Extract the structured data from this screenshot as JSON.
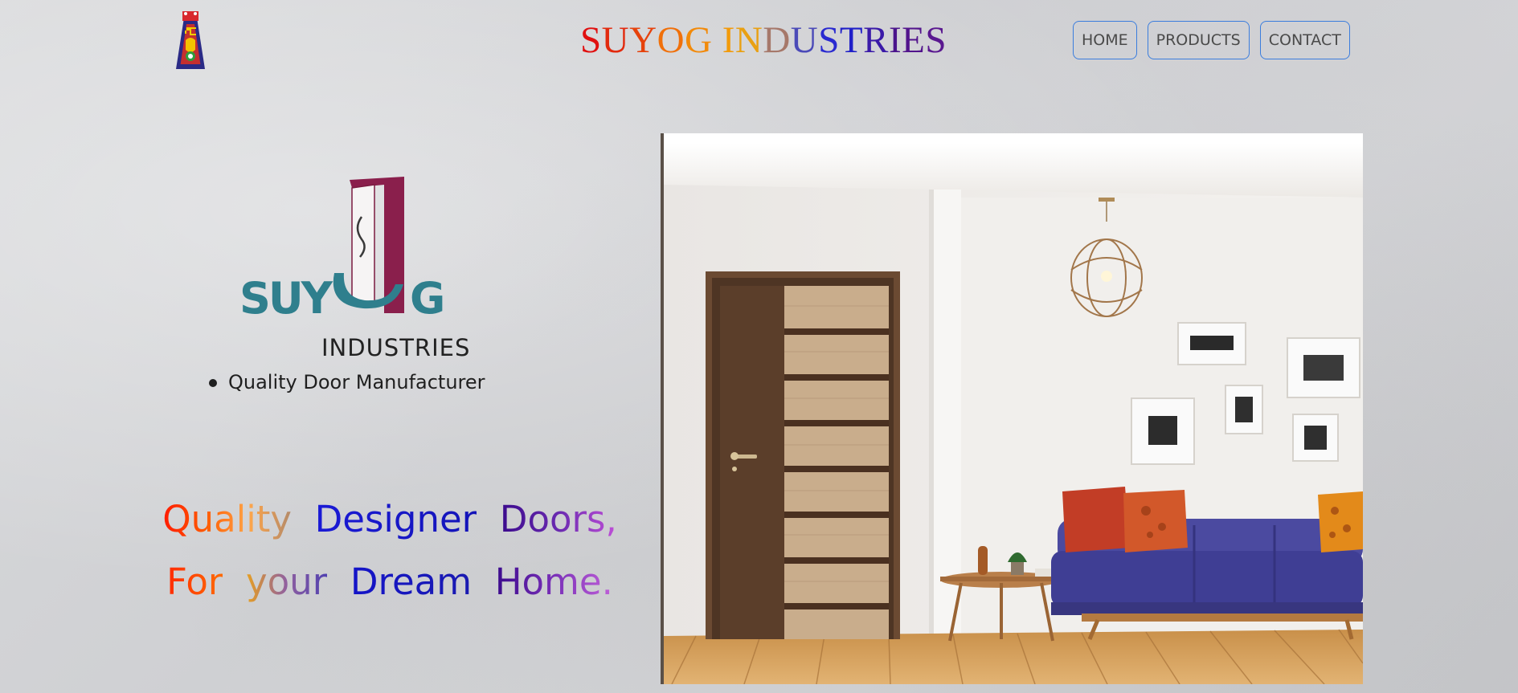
{
  "header": {
    "emblem_icon": "swastika-hand-emblem-icon",
    "title_letters": [
      {
        "ch": "S",
        "color": "#e01010"
      },
      {
        "ch": "U",
        "color": "#e22a0e"
      },
      {
        "ch": "Y",
        "color": "#e6420c"
      },
      {
        "ch": "O",
        "color": "#f0700a"
      },
      {
        "ch": "G",
        "color": "#f28a0a"
      },
      {
        "ch": " ",
        "color": "#000000"
      },
      {
        "ch": "I",
        "color": "#f29a0a"
      },
      {
        "ch": "N",
        "color": "#e9a012"
      },
      {
        "ch": "D",
        "color": "#a6786a"
      },
      {
        "ch": "U",
        "color": "#4b4ab8"
      },
      {
        "ch": "S",
        "color": "#2a2ad0"
      },
      {
        "ch": "T",
        "color": "#2020c8"
      },
      {
        "ch": "R",
        "color": "#3a1aa8"
      },
      {
        "ch": "I",
        "color": "#4a148c"
      },
      {
        "ch": "E",
        "color": "#52148c"
      },
      {
        "ch": "S",
        "color": "#5a1890"
      }
    ]
  },
  "nav": {
    "home": "HOME",
    "products": "PRODUCTS",
    "contact": "CONTACT",
    "border_color": "#3b7ddd"
  },
  "brand": {
    "logo_text": "SUYOG",
    "industries": "INDUSTRIES",
    "tagline": "Quality Door Manufacturer",
    "logo_teal": "#2f7f8d",
    "logo_maroon": "#8a1f4c"
  },
  "slogan": {
    "line1_words": [
      {
        "text": "Quality",
        "gradient": [
          "#ff1a00",
          "#ff5a00",
          "#ffa64a",
          "#b38a6a"
        ]
      },
      {
        "text": "Designer",
        "gradient": [
          "#1a1ad6",
          "#1414b8"
        ]
      },
      {
        "text": "Doors,",
        "gradient": [
          "#3a0a8c",
          "#6a2ab0",
          "#c050d8"
        ]
      }
    ],
    "line2_words": [
      {
        "text": "For",
        "gradient": [
          "#ff2a00",
          "#ff6a00"
        ]
      },
      {
        "text": "your",
        "gradient": [
          "#e8a020",
          "#9060a0",
          "#5040b0"
        ]
      },
      {
        "text": "Dream",
        "gradient": [
          "#1414c8",
          "#1a1ab0"
        ]
      },
      {
        "text": "Home.",
        "gradient": [
          "#3a0a8c",
          "#7a30b8",
          "#c060d8"
        ]
      }
    ]
  },
  "hero": {
    "image": "living-room-wooden-door-photo"
  }
}
